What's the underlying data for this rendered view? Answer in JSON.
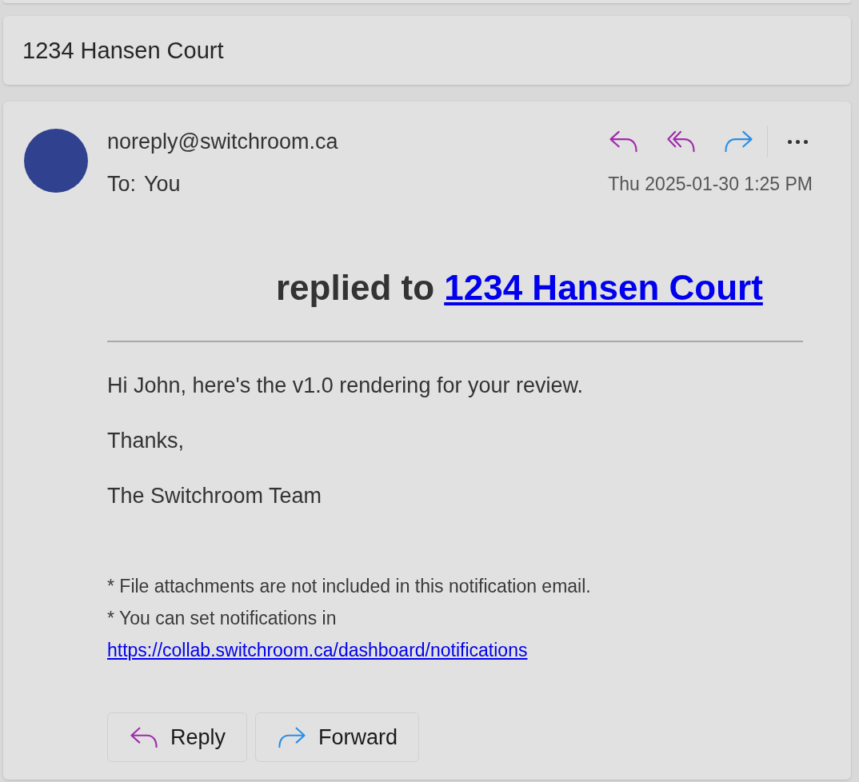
{
  "subject": "1234 Hansen Court",
  "message": {
    "sender": "noreply@switchroom.ca",
    "recipient_label": "To:",
    "recipient": "You",
    "timestamp": "Thu 2025-01-30 1:25 PM",
    "heading": "replied to",
    "heading_link": "1234 Hansen Court",
    "paragraphs": [
      "Hi John, here's the v1.0 rendering for your review.",
      "Thanks,",
      "The Switchroom Team"
    ],
    "footnotes": [
      {
        "text": "* File attachments are not included in this notification email."
      },
      {
        "text": "* You can set notifications in",
        "link": "https://collab.switchroom.ca/dashboard/notifications"
      }
    ],
    "buttons": [
      {
        "kind": "reply",
        "label": "Reply"
      },
      {
        "kind": "forward",
        "label": "Forward"
      }
    ]
  }
}
